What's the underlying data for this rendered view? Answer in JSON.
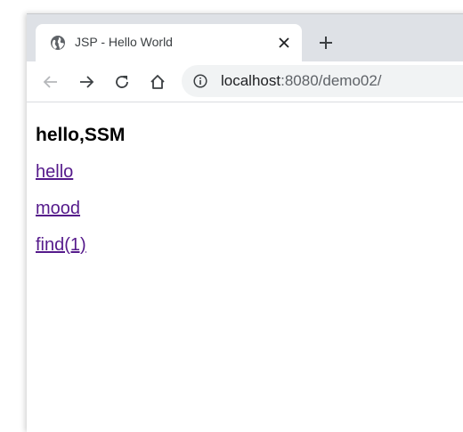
{
  "tab": {
    "title": "JSP - Hello World",
    "icon": "globe-icon"
  },
  "toolbar": {
    "url_host": "localhost",
    "url_rest": ":8080/demo02/"
  },
  "page": {
    "heading": "hello,SSM",
    "links": [
      "hello",
      "mood",
      "find(1)"
    ]
  },
  "colors": {
    "link_visited": "#551a8b",
    "tabstrip": "#dee1e6",
    "omnibox": "#f1f3f4"
  }
}
